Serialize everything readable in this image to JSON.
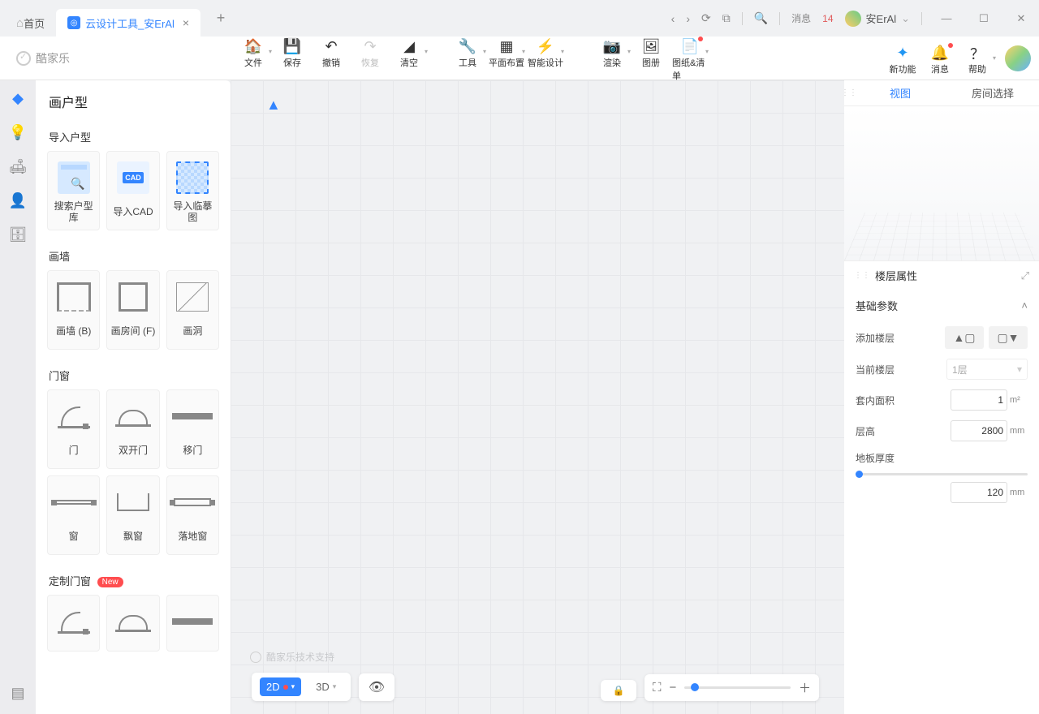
{
  "titlebar": {
    "tabs": [
      {
        "label": "首页",
        "active": false
      },
      {
        "label": "云设计工具_安ErAl",
        "active": true
      }
    ],
    "messages_label": "消息",
    "messages_count": "14",
    "username": "安ErAl"
  },
  "brand": "酷家乐",
  "toolbar": {
    "file": "文件",
    "save": "保存",
    "undo": "撤销",
    "redo": "恢复",
    "clear": "清空",
    "tools": "工具",
    "layout": "平面布置",
    "smart": "智能设计",
    "render": "渲染",
    "album": "图册",
    "drawing": "图纸&清单"
  },
  "right_toolbar": {
    "new": "新功能",
    "msg": "消息",
    "help": "帮助"
  },
  "panel": {
    "title": "画户型",
    "sec_import": "导入户型",
    "import": {
      "search": "搜索户型库",
      "cad": "导入CAD",
      "trace": "导入临摹图",
      "cad_badge": "CAD"
    },
    "sec_wall": "画墙",
    "wall": {
      "a": "画墙 (B)",
      "b": "画房间 (F)",
      "c": "画洞"
    },
    "sec_dw": "门窗",
    "dw": {
      "door": "门",
      "ddoor": "双开门",
      "slide": "移门",
      "win": "窗",
      "bay": "飘窗",
      "floor": "落地窗"
    },
    "sec_custom": "定制门窗",
    "new_badge": "New"
  },
  "canvas": {
    "watermark": "酷家乐技术支持"
  },
  "viewbar": {
    "v2d": "2D",
    "v3d": "3D"
  },
  "right": {
    "tab_view": "视图",
    "tab_room": "房间选择",
    "floor_props": "楼层属性",
    "basic": "基础参数",
    "add_floor": "添加楼层",
    "cur_floor": "当前楼层",
    "cur_floor_val": "1层",
    "area": "套内面积",
    "area_val": "1",
    "area_unit": "m²",
    "height": "层高",
    "height_val": "2800",
    "height_unit": "mm",
    "thick": "地板厚度",
    "thick_val": "120",
    "thick_unit": "mm"
  }
}
